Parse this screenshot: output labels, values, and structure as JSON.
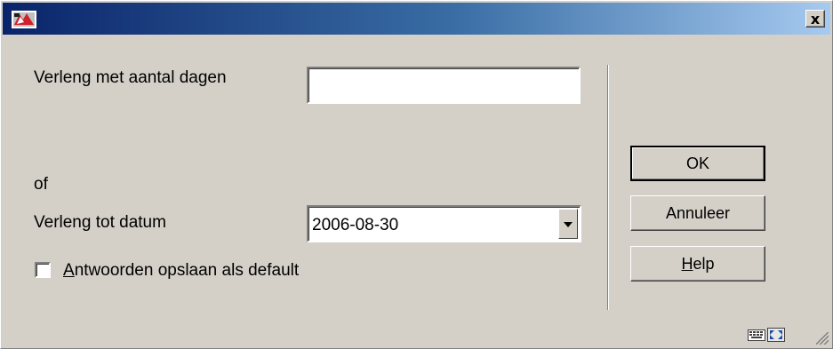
{
  "titlebar": {
    "app_icon": "library-app-icon",
    "close_label": "x"
  },
  "form": {
    "days_label": "Verleng met aantal dagen",
    "days_value": "",
    "or_label": "of",
    "date_label": "Verleng tot datum",
    "date_value": "2006-08-30",
    "save_defaults_label_underlined": "A",
    "save_defaults_label_rest": "ntwoorden opslaan als default",
    "save_defaults_checked": false
  },
  "buttons": {
    "ok_label": "OK",
    "cancel_label": "Annuleer",
    "help_underlined": "H",
    "help_rest": "elp"
  },
  "statusbar": {
    "icons": [
      "keyboard-icon",
      "fullscreen-icon",
      "resize-grip-icon"
    ]
  },
  "colors": {
    "titlebar_start": "#0a246a",
    "titlebar_end": "#a6caf0",
    "face": "#d4d0c8"
  }
}
